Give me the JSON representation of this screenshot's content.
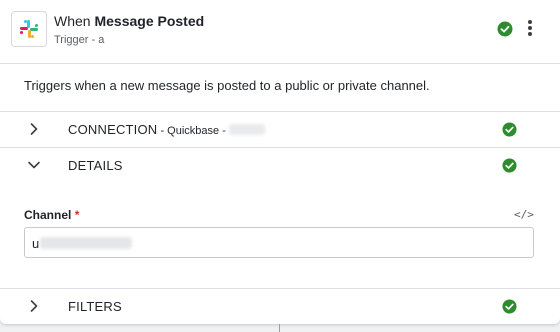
{
  "header": {
    "title_prefix": "When ",
    "title_bold": "Message Posted",
    "subtitle": "Trigger - a",
    "app_icon": "slack-logo-icon",
    "status_icon": "check-circle-icon",
    "menu_icon": "kebab-menu-icon"
  },
  "description": "Triggers when a new message is posted to a public or private channel.",
  "sections": {
    "connection": {
      "label": "CONNECTION",
      "detail": " - Quickbase - ",
      "icon": "chevron-right-icon"
    },
    "details": {
      "label": "DETAILS",
      "icon": "chevron-down-icon"
    },
    "filters": {
      "label": "FILTERS",
      "icon": "chevron-right-icon"
    }
  },
  "channel_field": {
    "label": "Channel",
    "required_mark": "*",
    "code_toggle": "</>",
    "value": "u"
  },
  "colors": {
    "success_green": "#2e8b2e",
    "required_red": "#d93025"
  }
}
